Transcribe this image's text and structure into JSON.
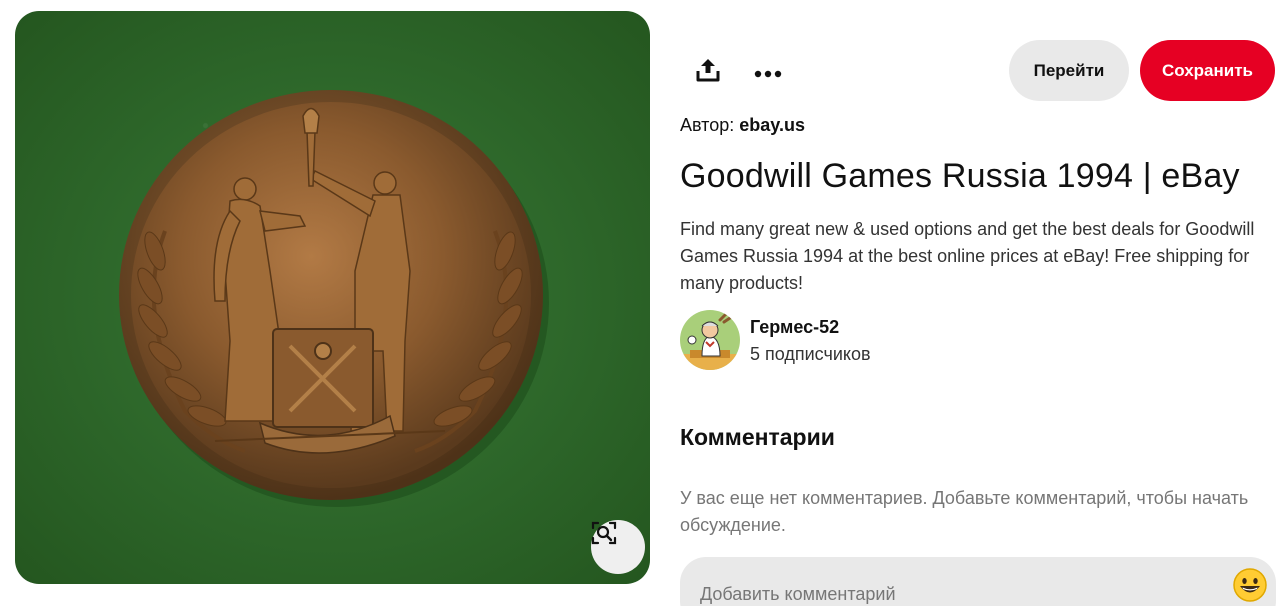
{
  "pin": {
    "image_alt": "Bronze medal with figures, torch and laurel wreath",
    "lens_icon": "visual-search-icon"
  },
  "toolbar": {
    "share_icon": "share-upload-icon",
    "more_icon": "ellipsis-icon",
    "visit_label": "Перейти",
    "save_label": "Сохранить"
  },
  "author": {
    "prefix": "Автор:",
    "source": "ebay.us"
  },
  "title": "Goodwill Games Russia 1994 | eBay",
  "description": "Find many great new & used options and get the best deals for Goodwill Games Russia 1994 at the best online prices at eBay! Free shipping for many products!",
  "creator": {
    "name": "Гермес-52",
    "followers": "5 подписчиков"
  },
  "comments": {
    "heading": "Комментарии",
    "empty_text": "У вас еще нет комментариев. Добавьте комментарий, чтобы начать обсуждение.",
    "input_placeholder": "Добавить комментарий",
    "emoji_icon": "smiley-emoji-icon"
  },
  "colors": {
    "save_button": "#e60023",
    "visit_button": "#e9e9e9",
    "comment_box": "#e9e9e9"
  }
}
